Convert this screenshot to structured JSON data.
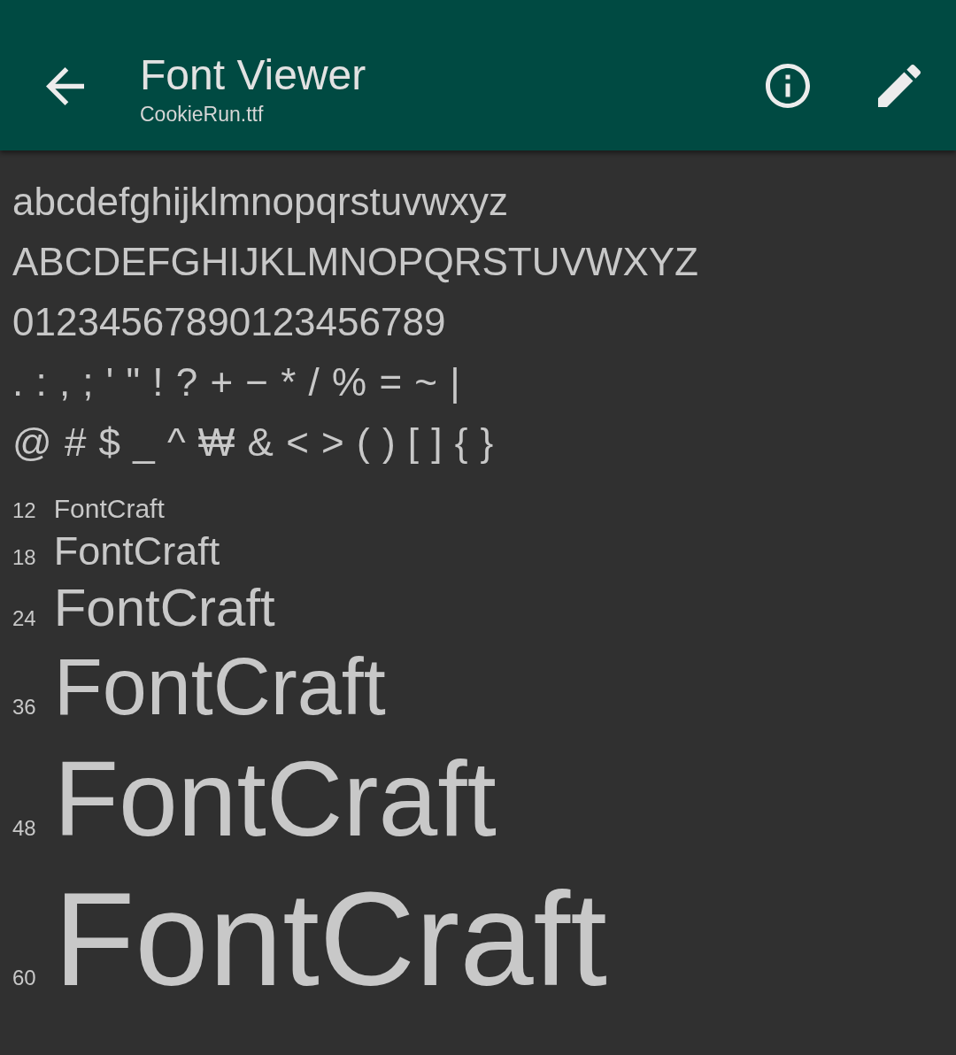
{
  "app_bar": {
    "title": "Font Viewer",
    "subtitle": "CookieRun.ttf"
  },
  "glyph_lines": [
    "abcdefghijklmnopqrstuvwxyz",
    "ABCDEFGHIJKLMNOPQRSTUVWXYZ",
    "01234567890123456789",
    ". : , ; ' \" ! ? + − * / % = ~ |",
    "@ # $ _ ^ ₩ & < > ( ) [ ] { }"
  ],
  "size_samples": [
    {
      "size": "12",
      "text": "FontCraft"
    },
    {
      "size": "18",
      "text": "FontCraft"
    },
    {
      "size": "24",
      "text": "FontCraft"
    },
    {
      "size": "36",
      "text": "FontCraft"
    },
    {
      "size": "48",
      "text": "FontCraft"
    },
    {
      "size": "60",
      "text": "FontCraft"
    }
  ]
}
